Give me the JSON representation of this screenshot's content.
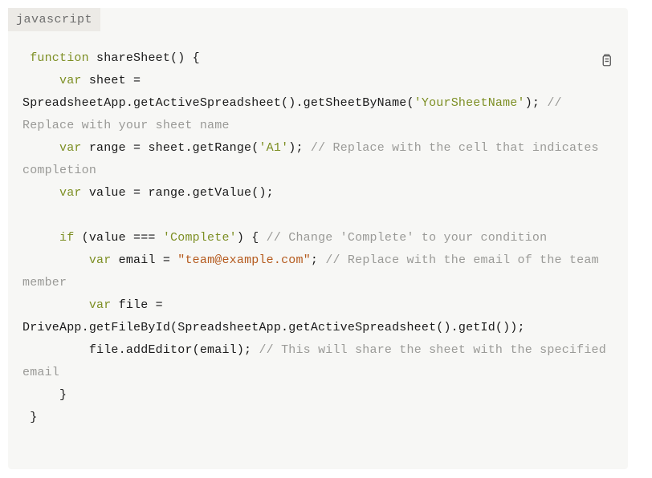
{
  "lang_label": "javascript",
  "code": {
    "l1a": " function",
    "l1b": " shareSheet() {",
    "l2a": "     var",
    "l2b": " sheet = SpreadsheetApp.getActiveSpreadsheet().getSheetByName(",
    "l2c": "'YourSheetName'",
    "l2d": "); ",
    "l2e": "// Replace with your sheet name",
    "l3a": "     var",
    "l3b": " range = sheet.getRange(",
    "l3c": "'A1'",
    "l3d": "); ",
    "l3e": "// Replace with the cell that indicates completion",
    "l4a": "     var",
    "l4b": " value = range.getValue();",
    "blank": "",
    "l5a": "     if",
    "l5b": " (value === ",
    "l5c": "'Complete'",
    "l5d": ") { ",
    "l5e": "// Change 'Complete' to your condition",
    "l6a": "         var",
    "l6b": " email = ",
    "l6c": "\"team@example.com\"",
    "l6d": "; ",
    "l6e": "// Replace with the email of the team member",
    "l7a": "         var",
    "l7b": " file = DriveApp.getFileById(SpreadsheetApp.getActiveSpreadsheet().getId());",
    "l8a": "         file.addEditor(email); ",
    "l8b": "// This will share the sheet with the specified email",
    "l9": "     }",
    "l10": " }"
  }
}
